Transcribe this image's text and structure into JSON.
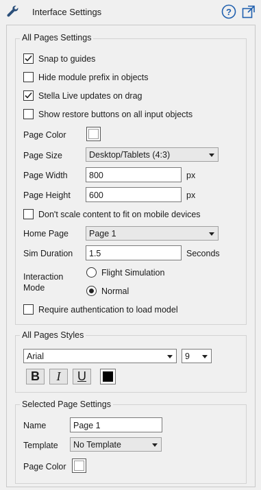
{
  "header": {
    "title": "Interface Settings",
    "icons": [
      "wrench-icon",
      "help-icon",
      "popout-icon"
    ]
  },
  "all_pages_settings": {
    "title": "All Pages Settings",
    "snap_to_guides": {
      "label": "Snap to guides",
      "checked": true
    },
    "hide_module_prefix": {
      "label": "Hide module prefix in objects",
      "checked": false
    },
    "stella_live_updates": {
      "label": "Stella Live updates on drag",
      "checked": true
    },
    "show_restore_buttons": {
      "label": "Show restore buttons on all input objects",
      "checked": false
    },
    "page_color": {
      "label": "Page Color",
      "value": "#ffffff"
    },
    "page_size": {
      "label": "Page Size",
      "value": "Desktop/Tablets (4:3)"
    },
    "page_width": {
      "label": "Page Width",
      "value": "800",
      "unit": "px"
    },
    "page_height": {
      "label": "Page Height",
      "value": "600",
      "unit": "px"
    },
    "dont_scale": {
      "label": "Don't scale content to fit on mobile devices",
      "checked": false
    },
    "home_page": {
      "label": "Home Page",
      "value": "Page 1"
    },
    "sim_duration": {
      "label": "Sim Duration",
      "value": "1.5",
      "unit": "Seconds"
    },
    "interaction_mode": {
      "label_line1": "Interaction",
      "label_line2": "Mode",
      "options": [
        {
          "label": "Flight Simulation",
          "selected": false
        },
        {
          "label": "Normal",
          "selected": true
        }
      ]
    },
    "require_auth": {
      "label": "Require authentication to load model",
      "checked": false
    }
  },
  "all_pages_styles": {
    "title": "All Pages Styles",
    "font": "Arial",
    "size": "9",
    "bold": "B",
    "italic": "I",
    "underline": "U",
    "text_color": "#000000"
  },
  "selected_page_settings": {
    "title": "Selected Page Settings",
    "name": {
      "label": "Name",
      "value": "Page 1"
    },
    "template": {
      "label": "Template",
      "value": "No Template"
    },
    "page_color": {
      "label": "Page Color",
      "value": "#ffffff"
    }
  }
}
